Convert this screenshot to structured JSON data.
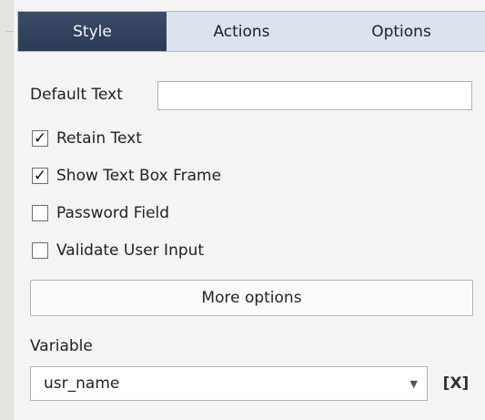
{
  "tabs": [
    {
      "label": "Style",
      "active": true
    },
    {
      "label": "Actions",
      "active": false
    },
    {
      "label": "Options",
      "active": false
    }
  ],
  "default_text": {
    "label": "Default Text",
    "value": ""
  },
  "checkboxes": [
    {
      "label": "Retain Text",
      "checked": true,
      "mark": "✓"
    },
    {
      "label": "Show Text Box Frame",
      "checked": true,
      "mark": "✓"
    },
    {
      "label": "Password Field",
      "checked": false,
      "mark": ""
    },
    {
      "label": "Validate User Input",
      "checked": false,
      "mark": ""
    }
  ],
  "more_options_label": "More options",
  "variable": {
    "label": "Variable",
    "selected": "usr_name",
    "dropdown_glyph": "▼",
    "clear_label": "[X]"
  },
  "colors": {
    "active_tab": "#34425e",
    "tab_bar": "#dde3ee",
    "panel_bg": "#f4f4f4"
  },
  "icons": [
    "checkmark-icon",
    "chevron-down-icon"
  ]
}
